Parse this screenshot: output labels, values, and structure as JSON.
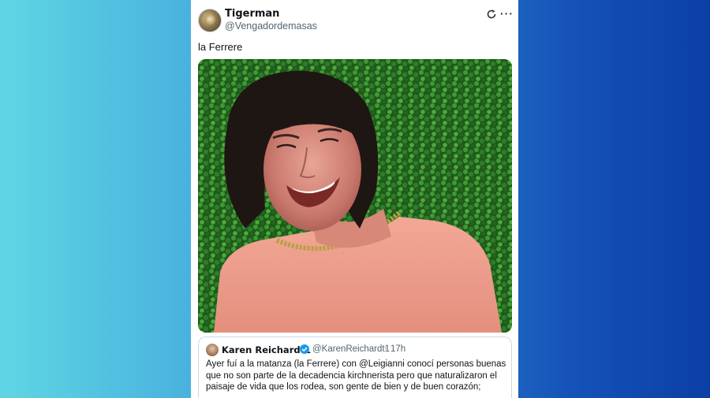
{
  "tweet": {
    "author_name": "Tigerman",
    "author_handle": "@Vengadordemasas",
    "text": "la Ferrere",
    "icons": [
      "refresh-icon",
      "more-icon"
    ],
    "more_glyph": "···"
  },
  "quoted_tweet": {
    "author_name": "Karen Reichardt1",
    "author_handle": "@KarenReichardt1",
    "separator": "·",
    "time": "17h",
    "verified": true,
    "text": "Ayer fuí a la matanza (la Ferrere) con @Leigianni conocí personas buenas que no son parte de la decadencia kirchnerista pero que naturalizaron el paisaje de vida que los rodea, son gente de bien y de buen corazón;"
  },
  "colors": {
    "background_left": "#5fd6e4",
    "background_right": "#0b3fa6",
    "card": "#ffffff",
    "handle_gray": "#536471",
    "verified_blue": "#1d9bf0"
  }
}
